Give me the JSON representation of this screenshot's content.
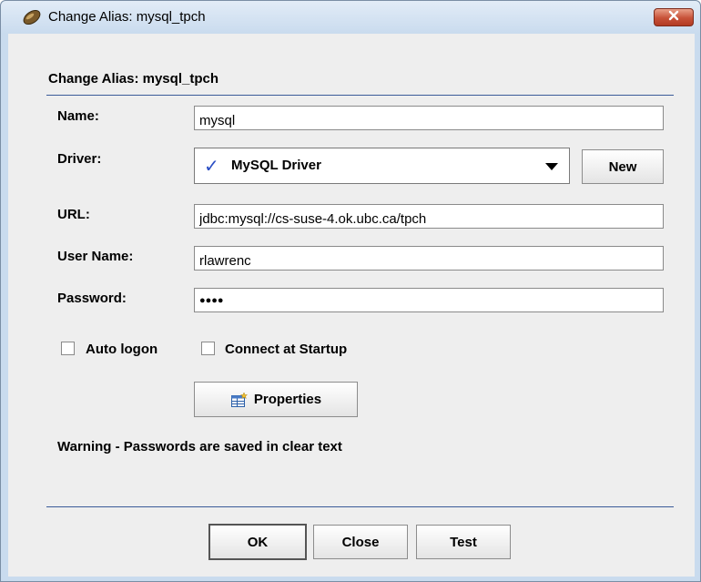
{
  "window": {
    "title": "Change Alias: mysql_tpch"
  },
  "header": {
    "title": "Change Alias: mysql_tpch"
  },
  "form": {
    "name": {
      "label": "Name:",
      "value": "mysql"
    },
    "driver": {
      "label": "Driver:",
      "selected": "MySQL Driver",
      "new_label": "New"
    },
    "url": {
      "label": "URL:",
      "value": "jdbc:mysql://cs-suse-4.ok.ubc.ca/tpch"
    },
    "user": {
      "label": "User Name:",
      "value": "rlawrenc"
    },
    "password": {
      "label": "Password:",
      "value": "●●●●"
    }
  },
  "options": {
    "auto_logon": {
      "label": "Auto logon",
      "checked": false
    },
    "connect_startup": {
      "label": "Connect at Startup",
      "checked": false
    }
  },
  "properties_label": "Properties",
  "warning": "Warning - Passwords are saved in clear text",
  "buttons": {
    "ok": "OK",
    "close": "Close",
    "test": "Test"
  },
  "colors": {
    "close_button": "#c75138",
    "accent_rule": "#3b5b99",
    "check_mark": "#2a4ec4"
  }
}
